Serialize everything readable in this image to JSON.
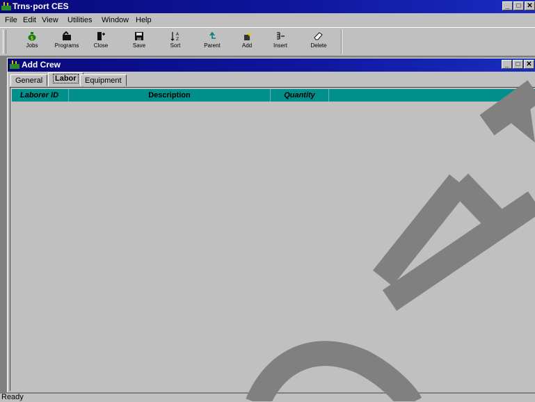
{
  "app": {
    "title": "Trns·port CES",
    "window_buttons": [
      "_",
      "□",
      "✕"
    ]
  },
  "menu": [
    "File",
    "Edit",
    "View",
    "Utilities",
    "Window",
    "Help"
  ],
  "toolbar": [
    {
      "label": "Jobs",
      "icon": "money-bag-icon"
    },
    {
      "label": "Programs",
      "icon": "programs-icon"
    },
    {
      "label": "Close",
      "icon": "close-door-icon"
    },
    {
      "label": "Save",
      "icon": "floppy-disk-icon"
    },
    {
      "label": "Sort",
      "icon": "sort-icon"
    },
    {
      "label": "Parent",
      "icon": "parent-arrow-icon"
    },
    {
      "label": "Add",
      "icon": "add-sparkle-icon"
    },
    {
      "label": "Insert",
      "icon": "insert-icon"
    },
    {
      "label": "Delete",
      "icon": "eraser-icon"
    }
  ],
  "child": {
    "title": "Add Crew",
    "window_buttons": [
      "_",
      "□",
      "✕"
    ],
    "tabs": [
      "General",
      "Labor",
      "Equipment"
    ],
    "active_tab": "Labor",
    "columns": [
      "Laborer ID",
      "Description",
      "Quantity"
    ]
  },
  "status": "Ready",
  "colors": {
    "titlebar": "#0a0a80",
    "grid_header": "#008f8a",
    "chrome": "#c0c0c0"
  }
}
